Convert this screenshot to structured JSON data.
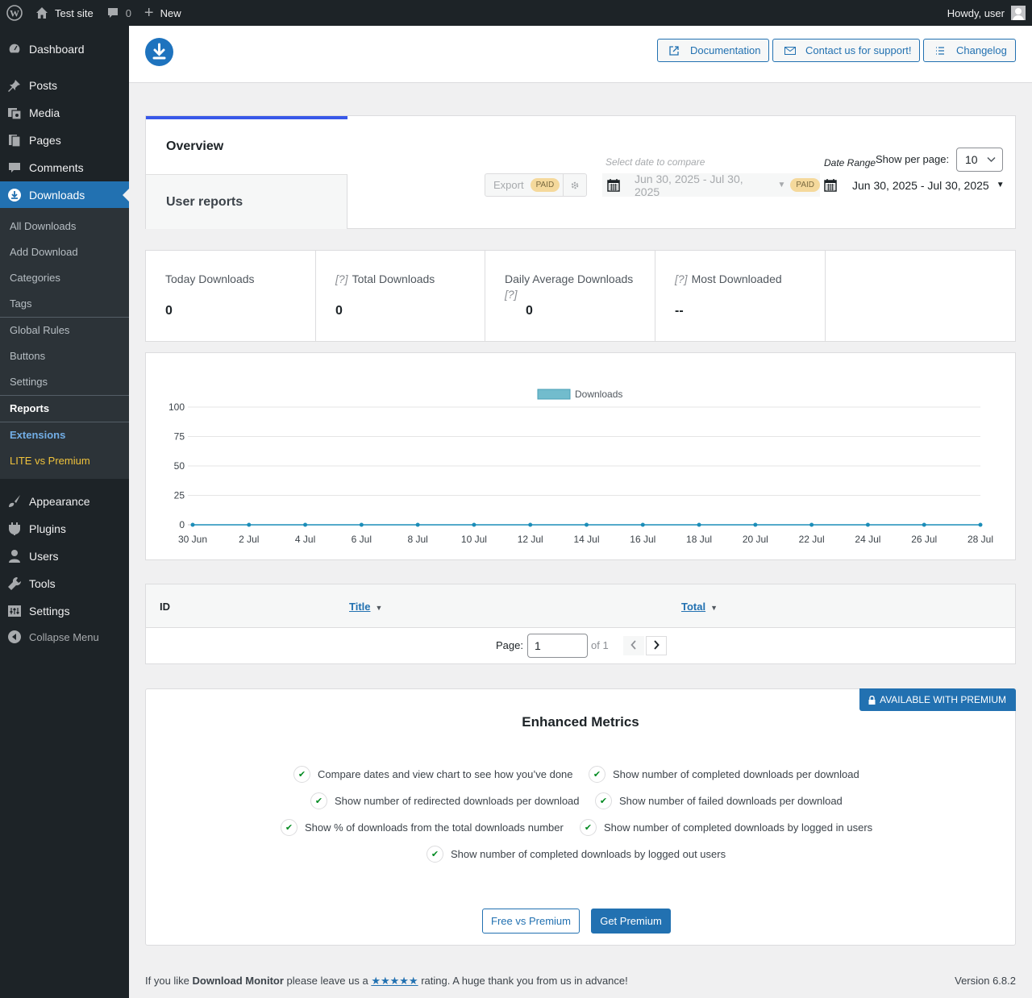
{
  "adminbar": {
    "site_name": "Test site",
    "comments_count": "0",
    "new_label": "New",
    "howdy": "Howdy, user"
  },
  "sidebar": {
    "items": [
      {
        "label": "Dashboard",
        "icon": "dashboard-icon"
      },
      {
        "label": "Posts",
        "icon": "pin-icon"
      },
      {
        "label": "Media",
        "icon": "media-icon"
      },
      {
        "label": "Pages",
        "icon": "pages-icon"
      },
      {
        "label": "Comments",
        "icon": "comment-icon"
      },
      {
        "label": "Downloads",
        "icon": "download-icon"
      },
      {
        "label": "Appearance",
        "icon": "brush-icon"
      },
      {
        "label": "Plugins",
        "icon": "plugin-icon"
      },
      {
        "label": "Users",
        "icon": "user-icon"
      },
      {
        "label": "Tools",
        "icon": "wrench-icon"
      },
      {
        "label": "Settings",
        "icon": "settings-icon"
      },
      {
        "label": "Collapse Menu",
        "icon": "collapse-icon"
      }
    ],
    "submenu": [
      "All Downloads",
      "Add Download",
      "Categories",
      "Tags",
      "Global Rules",
      "Buttons",
      "Settings",
      "Reports",
      "Extensions",
      "LITE vs Premium"
    ]
  },
  "header": {
    "documentation": "Documentation",
    "support": "Contact us for support!",
    "changelog": "Changelog"
  },
  "tabs": {
    "overview": "Overview",
    "user_reports": "User reports"
  },
  "filters": {
    "export_label": "Export",
    "paid_label": "PAID",
    "compare_label": "Select date to compare",
    "compare_range": "Jun 30, 2025 - Jul 30, 2025",
    "date_range_label": "Date Range",
    "date_range": "Jun 30, 2025 - Jul 30, 2025",
    "per_page_label": "Show per page:",
    "per_page_value": "10"
  },
  "stats": {
    "today_title": "Today Downloads",
    "today_value": "0",
    "total_title": "Total Downloads",
    "total_value": "0",
    "daily_avg_title": "Daily Average Downloads",
    "daily_avg_value": "0",
    "most_title": "Most Downloaded",
    "most_value": "--",
    "help_mark": "[?]"
  },
  "chart_data": {
    "type": "line",
    "series": [
      {
        "name": "Downloads",
        "values": [
          0,
          0,
          0,
          0,
          0,
          0,
          0,
          0,
          0,
          0,
          0,
          0,
          0,
          0,
          0
        ],
        "color": "#72bccd"
      }
    ],
    "x": [
      "30 Jun",
      "2 Jul",
      "4 Jul",
      "6 Jul",
      "8 Jul",
      "10 Jul",
      "12 Jul",
      "14 Jul",
      "16 Jul",
      "18 Jul",
      "20 Jul",
      "22 Jul",
      "24 Jul",
      "26 Jul",
      "28 Jul"
    ],
    "y_ticks": [
      0,
      25,
      50,
      75,
      100
    ],
    "ylim": [
      0,
      100
    ],
    "legend": "top-center",
    "grid": true
  },
  "table": {
    "col_id": "ID",
    "col_title": "Title",
    "col_total": "Total",
    "page_label": "Page:",
    "page_value": "1",
    "of_label": "of 1"
  },
  "premium": {
    "badge": "AVAILABLE WITH PREMIUM",
    "title": "Enhanced Metrics",
    "features": [
      "Compare dates and view chart to see how you’ve done",
      "Show number of completed downloads per download",
      "Show number of redirected downloads per download",
      "Show number of failed downloads per download",
      "Show % of downloads from the total downloads number",
      "Show number of completed downloads by logged in users",
      "Show number of completed downloads by logged out users"
    ],
    "free_vs_premium": "Free vs Premium",
    "get_premium": "Get Premium"
  },
  "footer": {
    "prefix": "If you like ",
    "plugin_name": "Download Monitor",
    "middle": " please leave us a ",
    "stars": "★★★★★",
    "suffix": " rating. A huge thank you from us in advance!",
    "version": "Version 6.8.2"
  },
  "colors": {
    "accent": "#2271b1",
    "tab_indicator": "#3858e9",
    "paid_badge": "#f5d99c",
    "premium_badge": "#2271b1"
  }
}
